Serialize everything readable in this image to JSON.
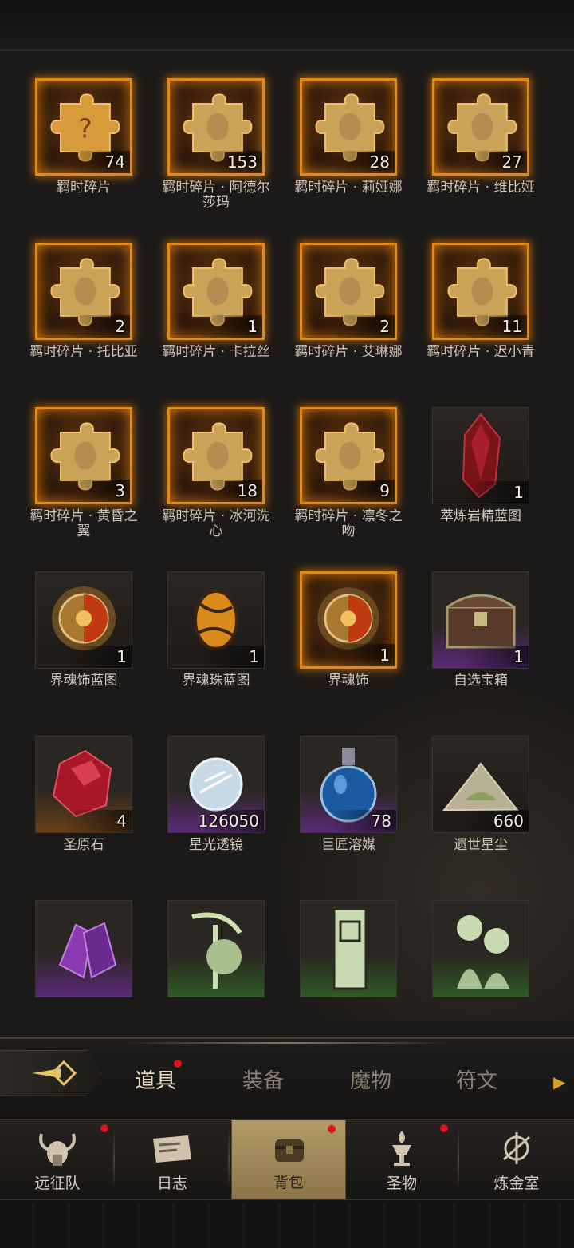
{
  "items": [
    {
      "label": "羁时碎片",
      "count": "74",
      "icon": "puzzle-question-icon",
      "frame": "orange"
    },
    {
      "label": "羁时碎片 · 阿德尔莎玛",
      "count": "153",
      "icon": "puzzle-piece-icon",
      "frame": "orange"
    },
    {
      "label": "羁时碎片 · 莉娅娜",
      "count": "28",
      "icon": "puzzle-piece-icon",
      "frame": "orange"
    },
    {
      "label": "羁时碎片 · 维比娅",
      "count": "27",
      "icon": "puzzle-piece-icon",
      "frame": "orange"
    },
    {
      "label": "羁时碎片 · 托比亚",
      "count": "2",
      "icon": "puzzle-piece-icon",
      "frame": "orange"
    },
    {
      "label": "羁时碎片 · 卡拉丝",
      "count": "1",
      "icon": "puzzle-piece-icon",
      "frame": "orange"
    },
    {
      "label": "羁时碎片 · 艾琳娜",
      "count": "2",
      "icon": "puzzle-piece-icon",
      "frame": "orange"
    },
    {
      "label": "羁时碎片 · 迟小青",
      "count": "11",
      "icon": "puzzle-piece-icon",
      "frame": "orange"
    },
    {
      "label": "羁时碎片 · 黄昏之翼",
      "count": "3",
      "icon": "puzzle-piece-icon",
      "frame": "orange"
    },
    {
      "label": "羁时碎片 · 冰河洗心",
      "count": "18",
      "icon": "puzzle-piece-icon",
      "frame": "orange"
    },
    {
      "label": "羁时碎片 · 凛冬之吻",
      "count": "9",
      "icon": "puzzle-piece-icon",
      "frame": "orange"
    },
    {
      "label": "萃炼岩精蓝图",
      "count": "1",
      "icon": "red-crystal-icon",
      "frame": "plain"
    },
    {
      "label": "界魂饰蓝图",
      "count": "1",
      "icon": "sun-amulet-icon",
      "frame": "plain"
    },
    {
      "label": "界魂珠蓝图",
      "count": "1",
      "icon": "amber-orb-icon",
      "frame": "plain"
    },
    {
      "label": "界魂饰",
      "count": "1",
      "icon": "sun-amulet-icon",
      "frame": "orange"
    },
    {
      "label": "自选宝箱",
      "count": "1",
      "icon": "treasure-chest-icon",
      "frame": "purple"
    },
    {
      "label": "圣原石",
      "count": "4",
      "icon": "red-gem-icon",
      "frame": "orangebg"
    },
    {
      "label": "星光透镜",
      "count": "126050",
      "icon": "crystal-lens-icon",
      "frame": "purple"
    },
    {
      "label": "巨匠溶媒",
      "count": "78",
      "icon": "potion-flask-icon",
      "frame": "purple"
    },
    {
      "label": "遗世星尘",
      "count": "660",
      "icon": "stardust-pile-icon",
      "frame": "plain"
    },
    {
      "label": "",
      "count": "",
      "icon": "purple-crystal-icon",
      "frame": "purple"
    },
    {
      "label": "",
      "count": "",
      "icon": "reaper-card-icon",
      "frame": "green"
    },
    {
      "label": "",
      "count": "",
      "icon": "monolith-card-icon",
      "frame": "green"
    },
    {
      "label": "",
      "count": "",
      "icon": "figures-card-icon",
      "frame": "green"
    }
  ],
  "categories": {
    "tabs": [
      "道具",
      "装备",
      "魔物",
      "符文"
    ],
    "active": "道具"
  },
  "nav": {
    "items": [
      "远征队",
      "日志",
      "背包",
      "圣物",
      "炼金室"
    ],
    "active": "背包"
  },
  "colors": {
    "frame_orange": "#e08a18",
    "badge_red": "#d8141c",
    "rarity_purple": "#5a2a78",
    "rarity_green": "#2e5a24"
  }
}
